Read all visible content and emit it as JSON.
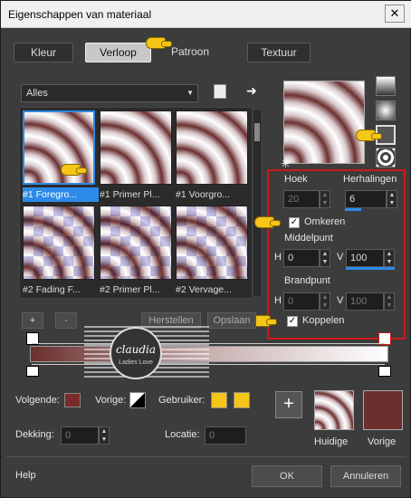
{
  "window": {
    "title": "Eigenschappen van materiaal",
    "close": "✕"
  },
  "tabs": [
    {
      "label": "Kleur",
      "active": false
    },
    {
      "label": "Verloop",
      "active": true
    },
    {
      "label": "Patroon",
      "active": false
    },
    {
      "label": "Textuur",
      "active": false
    }
  ],
  "gradient_category": "Alles",
  "gradients": [
    {
      "label": "#1 Foregro...",
      "selected": true
    },
    {
      "label": "#1 Primer Pl..."
    },
    {
      "label": "#1 Voorgro..."
    },
    {
      "label": "#2 Fading F..."
    },
    {
      "label": "#2 Primer Pl..."
    },
    {
      "label": "#2 Vervage..."
    }
  ],
  "buttons": {
    "add": "+",
    "remove": "-",
    "restore": "Herstellen",
    "save": "Opslaan",
    "ok": "OK",
    "cancel": "Annuleren",
    "help": "Help"
  },
  "settings": {
    "hoek_label": "Hoek",
    "hoek_value": "20",
    "herhalingen_label": "Herhalingen",
    "herhalingen_value": "6",
    "omkeren_label": "Omkeren",
    "omkeren_checked": true,
    "middelpunt_label": "Middelpunt",
    "mid_h_label": "H",
    "mid_h_value": "0",
    "mid_v_label": "V",
    "mid_v_value": "100",
    "brandpunt_label": "Brandpunt",
    "brand_h_label": "H",
    "brand_h_value": "0",
    "brand_v_label": "V",
    "brand_v_value": "100",
    "koppelen_label": "Koppelen",
    "koppelen_checked": true
  },
  "watermark": {
    "line1": "claudia",
    "line2": "Ladies Love"
  },
  "bottom": {
    "volgende_label": "Volgende:",
    "vorige_label": "Vorige:",
    "gebruiker_label": "Gebruiker:",
    "dekking_label": "Dekking:",
    "dekking_value": "0",
    "locatie_label": "Locatie:",
    "locatie_value": "0",
    "huidige_label": "Huidige",
    "vorige_swatch_label": "Vorige"
  },
  "colors": {
    "accent": "#2c8ae8",
    "highlight": "#e02020",
    "gebruiker": "#f5c518",
    "vorige": "#6b2f2f",
    "volgende": "#7a2a2a"
  }
}
